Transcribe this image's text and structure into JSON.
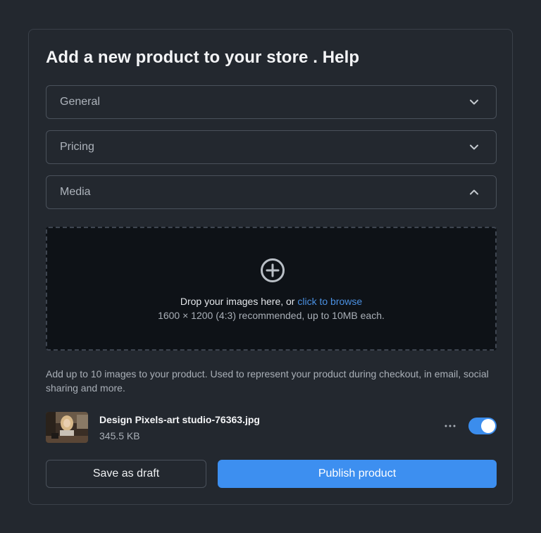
{
  "page": {
    "title": "Add a new product to your store . Help"
  },
  "sections": [
    {
      "label": "General",
      "expanded": false,
      "icon": "chevron-down-icon"
    },
    {
      "label": "Pricing",
      "expanded": false,
      "icon": "chevron-down-icon"
    },
    {
      "label": "Media",
      "expanded": true,
      "icon": "chevron-up-icon"
    }
  ],
  "dropzone": {
    "icon": "add-circle-icon",
    "prompt": "Drop your images here, or ",
    "browse_link": "click to browse",
    "hint": "1600 × 1200 (4:3) recommended, up to 10MB each."
  },
  "help_text": "Add up to 10 images to your product. Used to represent your product during checkout, in email, social sharing and more.",
  "file": {
    "name": "Design Pixels-art studio-76363.jpg",
    "size": "345.5 KB",
    "more_icon": "more-horizontal-icon",
    "enabled": true
  },
  "actions": {
    "draft_label": "Save as draft",
    "publish_label": "Publish product"
  },
  "colors": {
    "background": "#23282f",
    "dropzone": "#0e1217",
    "accent": "#3d8ff0",
    "link": "#4a90e2"
  }
}
